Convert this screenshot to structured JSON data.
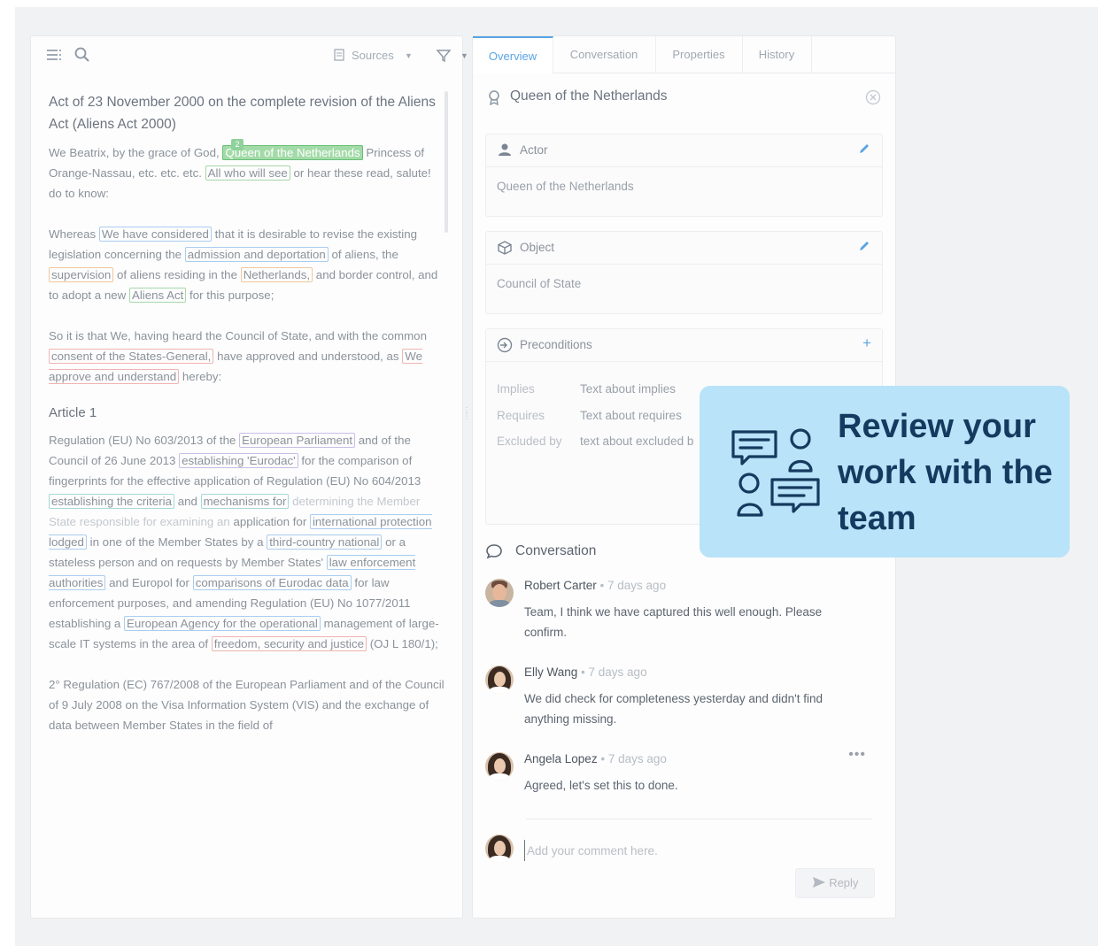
{
  "colors": {
    "accent": "#5aa4e4",
    "callout_bg": "#b8e3f8",
    "callout_text": "#153a5f"
  },
  "doc_panel": {
    "toolbar": {
      "menu_icon": "list-icon",
      "search_icon": "search-icon",
      "sources_label": "Sources",
      "filter_icon": "filter-icon"
    },
    "title": "Act of 23 November 2000 on the complete revision of the Aliens Act (Aliens Act 2000)",
    "badge": "2",
    "p1": {
      "a": "We Beatrix, by the grace of God,",
      "hl1": "Queen of the Netherlands",
      "b": "Princess of Orange-Nassau, etc. etc. etc.",
      "hl2": "All who will see",
      "c": "or hear these read, salute! do to know:"
    },
    "p2": {
      "a": "Whereas",
      "hl1": "We have considered",
      "b": "that it is desirable to revise the existing legislation concerning the",
      "hl2": "admission and deportation",
      "c": "of aliens, the",
      "hl3": "supervision",
      "d": "of aliens residing in the",
      "hl4": "Netherlands,",
      "e": "and border control, and to adopt a new",
      "hl5": "Aliens Act",
      "f": "for this purpose;"
    },
    "p3": {
      "a": "So it is that We, having heard the Council of State, and with the common",
      "hl1": "consent of the States-General,",
      "b": "have approved and understood, as",
      "hl2": "We approve and understand",
      "c": "hereby:"
    },
    "heading": "Article 1",
    "p4": {
      "a": "Regulation (EU) No 603/2013 of the",
      "hl1": "European Parliament",
      "b": "and of the Council of 26 June 2013",
      "hl2": "establishing 'Eurodac'",
      "c": "for the comparison of fingerprints for the effective application of Regulation (EU) No 604/2013",
      "hl3": "establishing the criteria",
      "d": "and",
      "hl4": "mechanisms for",
      "e": "determining the Member State responsible for examining an",
      "f": "application for",
      "hl5": "international protection lodged",
      "g": "in one of the Member States by a",
      "hl6": "third-country national",
      "h": "or a stateless person and on requests by Member States'",
      "hl7": "law enforcement authorities",
      "i": "and Europol for",
      "hl8": "comparisons of Eurodac data",
      "j": "for law enforcement purposes, and amending Regulation (EU) No 1077/2011 establishing a",
      "hl9": "European Agency for the operational",
      "k": "management of large-scale IT systems in the area of",
      "hl10": "freedom, security and justice",
      "l": "(OJ L 180/1);"
    },
    "p5": "2° Regulation (EC) 767/2008 of the European Parliament and of the Council of 9 July 2008 on the Visa Information System (VIS) and the exchange of data between Member States in the field of"
  },
  "detail_panel": {
    "tabs": [
      "Overview",
      "Conversation",
      "Properties",
      "History"
    ],
    "title": "Queen of the Netherlands",
    "title_icon": "award-icon",
    "close_icon": "close-circle-icon",
    "actor": {
      "label": "Actor",
      "value": "Queen of the Netherlands",
      "icon": "person-icon",
      "action_icon": "pencil-icon"
    },
    "object": {
      "label": "Object",
      "value": "Council of State",
      "icon": "cube-icon",
      "action_icon": "pencil-icon"
    },
    "preconditions": {
      "label": "Preconditions",
      "icon": "login-circle-icon",
      "action_icon": "plus-icon",
      "rows": [
        {
          "key": "Implies",
          "value": "Text about implies"
        },
        {
          "key": "Requires",
          "value": "Text about requires"
        },
        {
          "key": "Excluded by",
          "value": "text about excluded b"
        }
      ]
    },
    "conversation": {
      "label": "Conversation",
      "icon": "chat-bubble-icon",
      "comments": [
        {
          "name": "Robert Carter",
          "time": "• 7 days ago",
          "text": "Team, I think we have captured this well enough. Please confirm."
        },
        {
          "name": "Elly Wang",
          "time": "• 7 days ago",
          "text": "We did check for completeness yesterday and didn't find anything missing."
        },
        {
          "name": "Angela Lopez",
          "time": "• 7 days ago",
          "text": "Agreed, let's set this to done."
        }
      ],
      "more_label": "•••",
      "input_placeholder": "Add your comment here.",
      "reply_label": "Reply",
      "reply_icon": "send-icon"
    }
  },
  "callout": {
    "headline": "Review your work with the team",
    "icon": "team-chat-icon"
  }
}
